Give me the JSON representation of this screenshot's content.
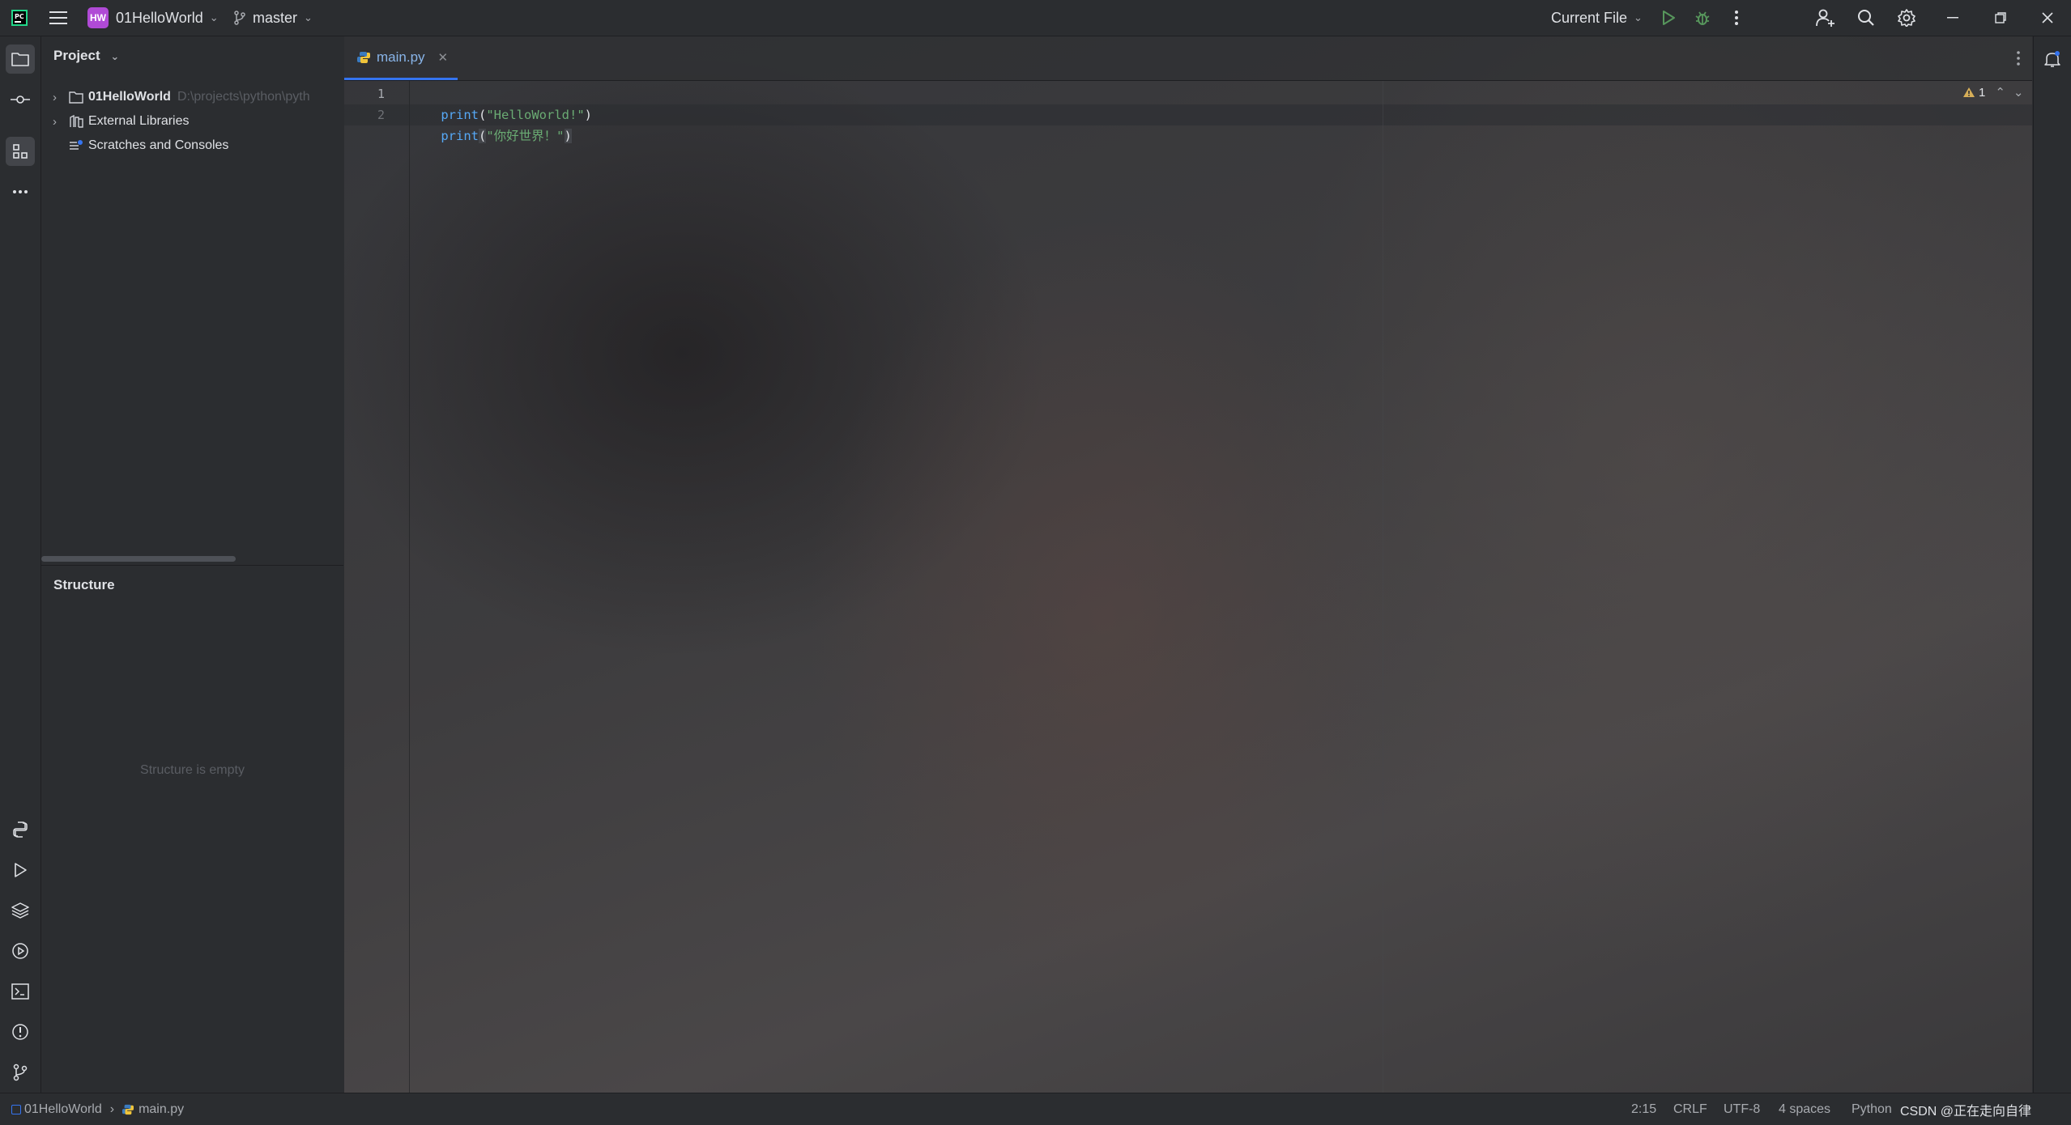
{
  "titlebar": {
    "project_badge": "HW",
    "project_name": "01HelloWorld",
    "branch": "master",
    "run_config": "Current File"
  },
  "project_panel": {
    "title": "Project",
    "tree": [
      {
        "label": "01HelloWorld",
        "path": "D:\\projects\\python\\pyth"
      },
      {
        "label": "External Libraries"
      },
      {
        "label": "Scratches and Consoles"
      }
    ]
  },
  "structure_panel": {
    "title": "Structure",
    "empty_text": "Structure is empty"
  },
  "editor": {
    "tab_label": "main.py",
    "warning_count": "1",
    "lines": [
      {
        "number": "1",
        "fn": "print",
        "open": "(",
        "str": "\"HelloWorld!\"",
        "close": ")"
      },
      {
        "number": "2",
        "fn": "print",
        "open": "(",
        "str": "\"你好世界！\"",
        "close": ")"
      }
    ]
  },
  "statusbar": {
    "breadcrumb_project": "01HelloWorld",
    "breadcrumb_file": "main.py",
    "position": "2:15",
    "line_ending": "CRLF",
    "encoding": "UTF-8",
    "indent": "4 spaces",
    "interpreter": "Python",
    "watermark": "CSDN @正在走向自律"
  },
  "colors": {
    "accent": "#3574f0",
    "badge": "#b04ad6",
    "run": "#57965c",
    "warning": "#d6ae58"
  }
}
